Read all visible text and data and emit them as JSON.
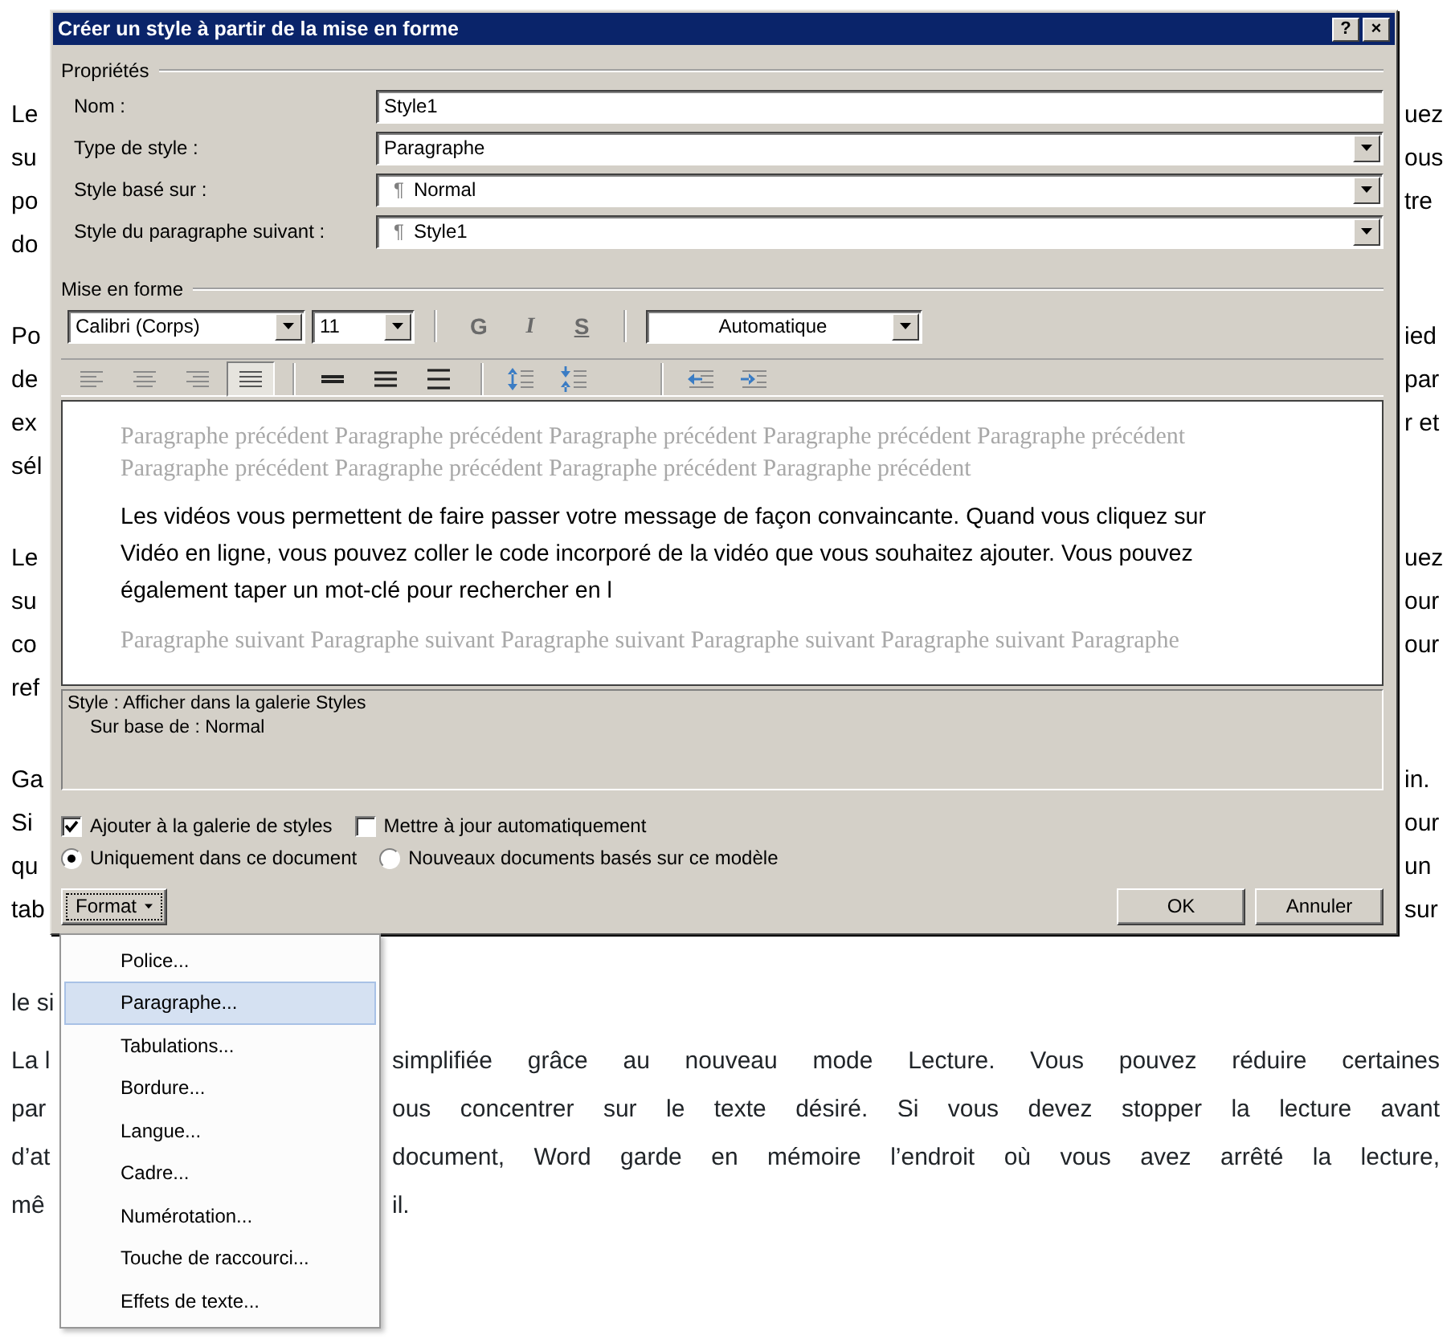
{
  "document": {
    "beside_dialog": [
      {
        "lines": [
          {
            "left": "Le",
            "right": "uez"
          },
          {
            "left": "su",
            "right": "ous"
          },
          {
            "left": "po",
            "right": "tre"
          },
          {
            "left": "do"
          }
        ]
      },
      {
        "lines": [
          {
            "left": "Po",
            "right": "ied"
          },
          {
            "left": "de",
            "right": "par"
          },
          {
            "left": "ex",
            "right": "r et"
          },
          {
            "left": "sél"
          }
        ]
      },
      {
        "lines": [
          {
            "left": "Le",
            "right": "uez"
          },
          {
            "left": "su",
            "right": "our"
          },
          {
            "left": "co",
            "right": "our"
          },
          {
            "left": "ref"
          }
        ]
      },
      {
        "lines": [
          {
            "left": "Ga",
            "right": "in."
          },
          {
            "left": "Si",
            "right": "our"
          },
          {
            "left": "qu",
            "right": "un"
          },
          {
            "left": "tab",
            "right": "sur"
          }
        ]
      }
    ],
    "below_dialog": [
      {
        "lines": [
          {
            "left": "le si"
          }
        ]
      },
      {
        "lines": [
          {
            "left": "La l",
            "right": "simplifiée grâce au nouveau mode Lecture. Vous pouvez réduire certaines"
          },
          {
            "left": "par",
            "right": "ous concentrer sur le texte désiré. Si vous devez stopper la lecture avant"
          },
          {
            "left": "d’at",
            "right": "document, Word garde en mémoire l’endroit où vous avez arrêté la lecture,"
          },
          {
            "left": "mê",
            "right": "il."
          }
        ]
      }
    ]
  },
  "dialog": {
    "title": "Créer un style à partir de la mise en forme",
    "title_buttons": [
      "?",
      "×"
    ],
    "properties": {
      "heading": "Propriétés",
      "fields": [
        {
          "kind": "text",
          "label": "Nom :",
          "value": "Style1"
        },
        {
          "kind": "dropdown",
          "label": "Type de style :",
          "value": "Paragraphe"
        },
        {
          "kind": "dropdown",
          "label": "Style basé sur :",
          "prefix": "¶",
          "value": "Normal"
        },
        {
          "kind": "dropdown",
          "label": "Style du paragraphe suivant :",
          "prefix": "¶",
          "value": "Style1"
        }
      ]
    },
    "formatting": {
      "heading": "Mise en forme",
      "font": "Calibri (Corps)",
      "size": "11",
      "style_buttons": [
        {
          "kind": "bold",
          "label": "G",
          "pressed": false
        },
        {
          "kind": "italic",
          "label": "I",
          "pressed": false
        },
        {
          "kind": "underline",
          "label": "S",
          "pressed": false
        }
      ],
      "color_choice": "Automatique",
      "paragraph_groups": [
        {
          "buttons": [
            {
              "kind": "align-left",
              "selected": false
            },
            {
              "kind": "align-center",
              "selected": false
            },
            {
              "kind": "align-right",
              "selected": false
            },
            {
              "kind": "justify",
              "selected": true
            }
          ]
        },
        {
          "buttons": [
            {
              "kind": "single-spacing",
              "selected": false
            },
            {
              "kind": "one-half-spacing",
              "selected": false
            },
            {
              "kind": "double-spacing",
              "selected": false
            }
          ]
        },
        {
          "buttons": [
            {
              "kind": "increase-spacing",
              "selected": false
            },
            {
              "kind": "decrease-spacing",
              "selected": false
            }
          ]
        },
        {
          "buttons": [
            {
              "kind": "decrease-indent",
              "selected": false
            },
            {
              "kind": "increase-indent",
              "selected": false
            }
          ]
        }
      ]
    },
    "preview": {
      "previous_lines": [
        "Paragraphe précédent Paragraphe précédent Paragraphe précédent Paragraphe précédent Paragraphe précédent",
        "Paragraphe précédent Paragraphe précédent Paragraphe précédent Paragraphe précédent"
      ],
      "sample_lines": [
        "Les vidéos vous permettent de faire passer votre message de façon convaincante. Quand vous cliquez sur",
        "Vidéo en ligne, vous pouvez coller le code incorporé de la vidéo que vous souhaitez ajouter. Vous pouvez",
        "également taper un mot-clé pour rechercher en l"
      ],
      "next_lines": [
        "Paragraphe suivant Paragraphe suivant Paragraphe suivant Paragraphe suivant Paragraphe suivant Paragraphe"
      ]
    },
    "description": [
      "Style : Afficher dans la galerie Styles",
      "Sur base de : Normal"
    ],
    "options": [
      {
        "label": "Ajouter à la galerie de styles",
        "checked": true
      },
      {
        "label": "Mettre à jour automatiquement",
        "checked": false
      }
    ],
    "scope": [
      {
        "label": "Uniquement dans ce document",
        "selected": true
      },
      {
        "label": "Nouveaux documents basés sur ce modèle",
        "selected": false
      }
    ],
    "format_button": "Format",
    "buttons": [
      "OK",
      "Annuler"
    ]
  },
  "format_menu": {
    "items": [
      {
        "label": "Police...",
        "selected": false
      },
      {
        "label": "Paragraphe...",
        "selected": true
      },
      {
        "label": "Tabulations...",
        "selected": false
      },
      {
        "label": "Bordure...",
        "selected": false
      },
      {
        "label": "Langue...",
        "selected": false
      },
      {
        "label": "Cadre...",
        "selected": false
      },
      {
        "label": "Numérotation...",
        "selected": false
      },
      {
        "label": "Touche de raccourci...",
        "selected": false
      },
      {
        "label": "Effets de texte...",
        "selected": false
      }
    ]
  }
}
